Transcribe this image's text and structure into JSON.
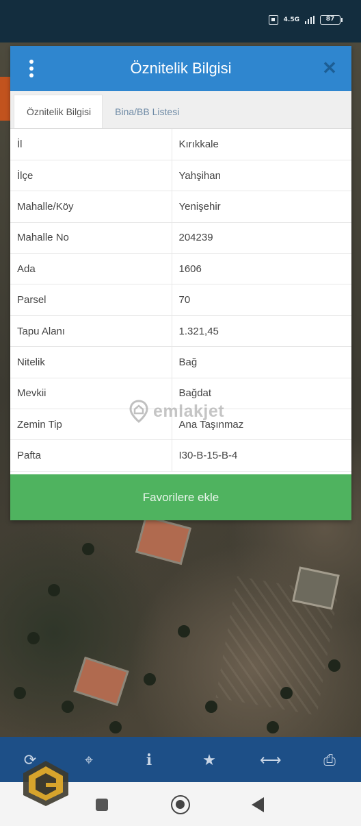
{
  "status_bar": {
    "network": "4.5G",
    "battery": "87"
  },
  "panel": {
    "title": "Öznitelik Bilgisi",
    "tabs": [
      {
        "label": "Öznitelik Bilgisi",
        "active": true
      },
      {
        "label": "Bina/BB Listesi",
        "active": false
      }
    ],
    "rows": [
      {
        "key": "İl",
        "value": "Kırıkkale"
      },
      {
        "key": "İlçe",
        "value": "Yahşihan"
      },
      {
        "key": "Mahalle/Köy",
        "value": "Yenişehir"
      },
      {
        "key": "Mahalle No",
        "value": "204239"
      },
      {
        "key": "Ada",
        "value": "1606"
      },
      {
        "key": "Parsel",
        "value": "70"
      },
      {
        "key": "Tapu Alanı",
        "value": "1.321,45"
      },
      {
        "key": "Nitelik",
        "value": "Bağ"
      },
      {
        "key": "Mevkii",
        "value": "Bağdat"
      },
      {
        "key": "Zemin Tip",
        "value": "Ana Taşınmaz"
      },
      {
        "key": "Pafta",
        "value": "I30-B-15-B-4"
      }
    ],
    "favorite_label": "Favorilere ekle"
  },
  "watermark": "emlakjet",
  "toolbar": {
    "icons": [
      "refresh-icon",
      "locate-icon",
      "info-icon",
      "star-icon",
      "measure-icon",
      "print-icon"
    ]
  },
  "colors": {
    "header": "#2f86cf",
    "favorite_button": "#4fb35f",
    "toolbar": "#1d4f87",
    "status_bar": "#132d3e"
  }
}
